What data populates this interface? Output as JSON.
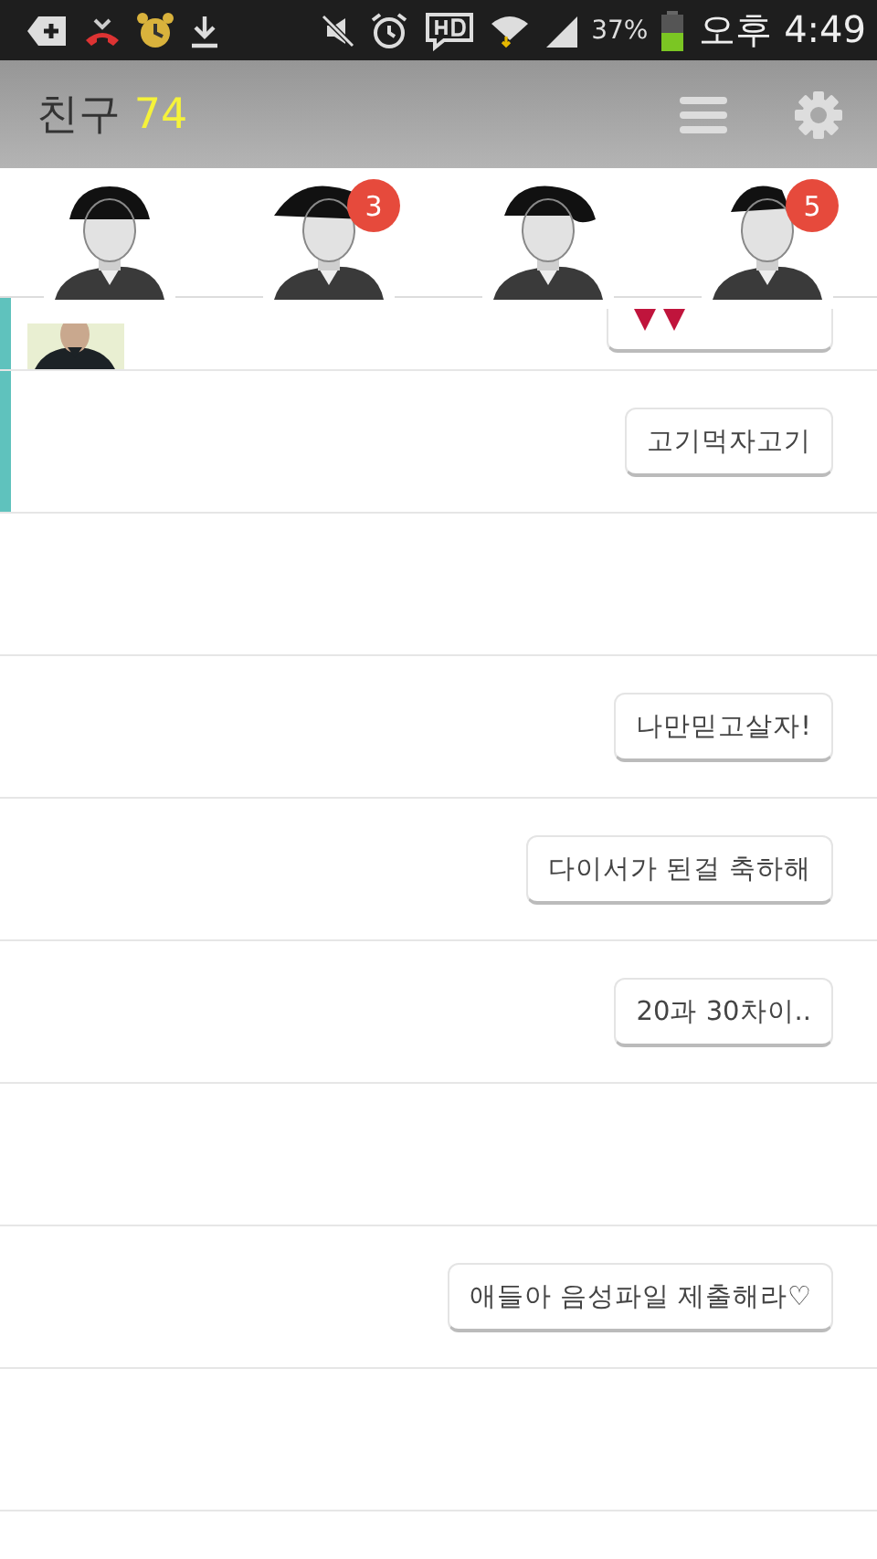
{
  "status_bar": {
    "battery": "37%",
    "time": "오후 4:49"
  },
  "header": {
    "title": "친구",
    "count": "74"
  },
  "favorites": [
    {
      "kind": "picture"
    },
    {
      "kind": "picture",
      "badge": "3"
    },
    {
      "kind": "picture"
    },
    {
      "kind": "picture",
      "badge": "5"
    }
  ],
  "rows": [
    {
      "kind": "partial",
      "highlighted": true,
      "message": ""
    },
    {
      "kind": "message",
      "highlighted": true,
      "message": "고기먹자고기"
    },
    {
      "kind": "empty",
      "highlighted": false,
      "message": ""
    },
    {
      "kind": "message",
      "highlighted": false,
      "message": "나만믿고살자!"
    },
    {
      "kind": "message",
      "highlighted": false,
      "message": "다이서가 된걸 축하해"
    },
    {
      "kind": "message",
      "highlighted": false,
      "message": "20과 30차이.."
    },
    {
      "kind": "empty",
      "highlighted": false,
      "message": ""
    },
    {
      "kind": "message",
      "highlighted": false,
      "message": "애들아 음성파일 제출해라♡"
    },
    {
      "kind": "empty",
      "highlighted": false,
      "message": ""
    },
    {
      "kind": "empty",
      "highlighted": false,
      "message": ""
    }
  ]
}
